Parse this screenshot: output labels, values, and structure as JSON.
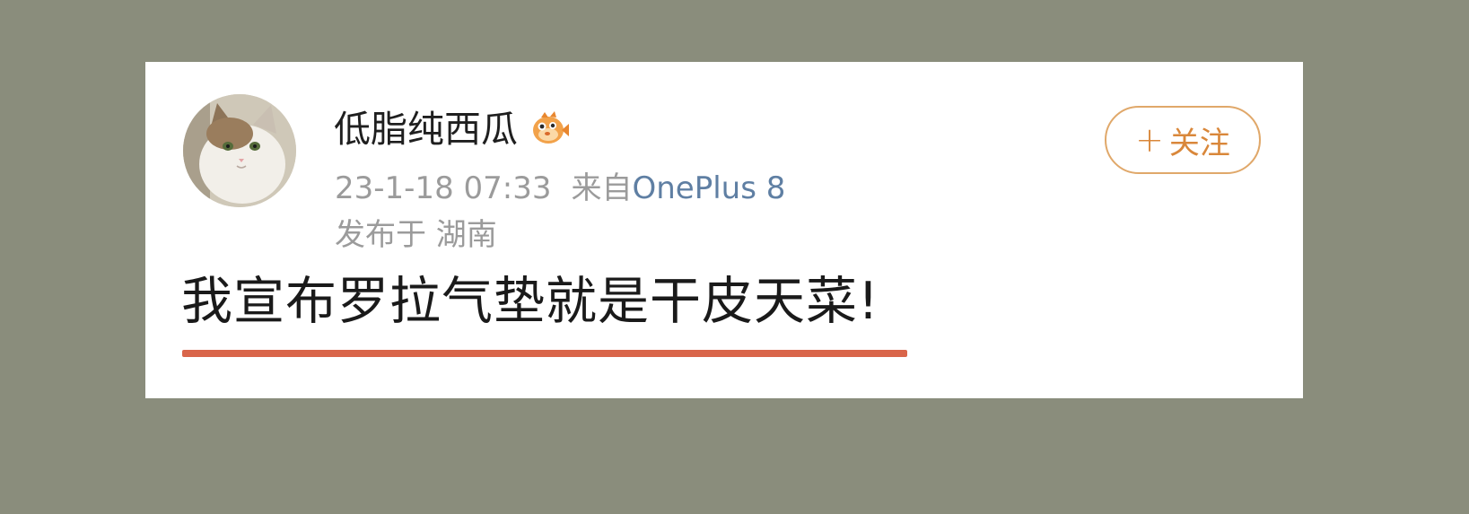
{
  "post": {
    "username": "低脂纯西瓜",
    "badge_icon": "pufferfish-badge-icon",
    "timestamp": "23-1-18 07:33",
    "source_prefix": "来自",
    "device": "OnePlus 8",
    "location": "发布于 湖南",
    "content": "我宣布罗拉气垫就是干皮天菜!",
    "follow_plus": "+",
    "follow_label": "关注"
  },
  "colors": {
    "background": "#8a8d7c",
    "card": "#ffffff",
    "follow_accent": "#d9873a",
    "device_link": "#5f7fa3",
    "underline": "#d9654a"
  }
}
